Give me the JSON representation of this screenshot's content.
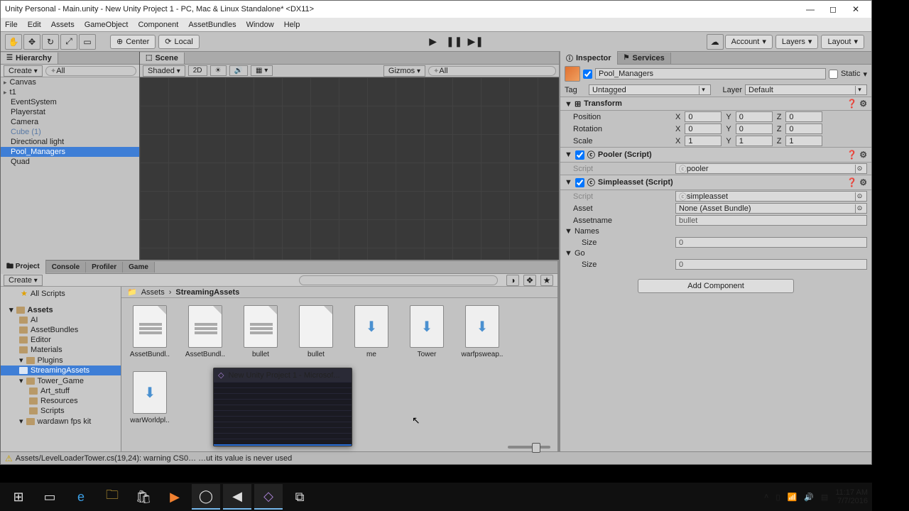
{
  "window": {
    "title": "Unity Personal - Main.unity - New Unity Project 1 - PC, Mac & Linux Standalone* <DX11>"
  },
  "menu": [
    "File",
    "Edit",
    "Assets",
    "GameObject",
    "Component",
    "AssetBundles",
    "Window",
    "Help"
  ],
  "toolbar": {
    "center": "Center",
    "local": "Local",
    "account": "Account",
    "layers": "Layers",
    "layout": "Layout"
  },
  "hierarchy": {
    "title": "Hierarchy",
    "create": "Create",
    "search_ph": "All",
    "items": [
      {
        "label": "Canvas",
        "exp": true
      },
      {
        "label": "t1",
        "exp": true
      },
      {
        "label": "EventSystem"
      },
      {
        "label": "Playerstat"
      },
      {
        "label": "Camera"
      },
      {
        "label": "Cube (1)",
        "dim": true
      },
      {
        "label": "Directional light"
      },
      {
        "label": "Pool_Managers",
        "sel": true
      },
      {
        "label": "Quad"
      }
    ]
  },
  "scene": {
    "tab": "Scene",
    "shaded": "Shaded",
    "twoD": "2D",
    "gizmos": "Gizmos",
    "search_ph": "All"
  },
  "project": {
    "tabs": [
      "Project",
      "Console",
      "Profiler",
      "Game"
    ],
    "create": "Create",
    "tree_top": [
      {
        "label": "All Scripts"
      }
    ],
    "tree": [
      {
        "label": "Assets",
        "bold": true,
        "indent": 0,
        "exp": true
      },
      {
        "label": "AI",
        "indent": 1
      },
      {
        "label": "AssetBundles",
        "indent": 1
      },
      {
        "label": "Editor",
        "indent": 1
      },
      {
        "label": "Materials",
        "indent": 1
      },
      {
        "label": "Plugins",
        "indent": 1,
        "exp": true
      },
      {
        "label": "StreamingAssets",
        "indent": 1,
        "sel": true
      },
      {
        "label": "Tower_Game",
        "indent": 1,
        "exp": true
      },
      {
        "label": "Art_stuff",
        "indent": 2
      },
      {
        "label": "Resources",
        "indent": 2
      },
      {
        "label": "Scripts",
        "indent": 2
      },
      {
        "label": "wardawn fps kit",
        "indent": 1,
        "exp": true
      }
    ],
    "breadcrumb": [
      "Assets",
      "StreamingAssets"
    ],
    "assets": [
      {
        "label": "AssetBundl..",
        "kind": "data"
      },
      {
        "label": "AssetBundl..",
        "kind": "data"
      },
      {
        "label": "bullet",
        "kind": "data"
      },
      {
        "label": "bullet",
        "kind": "blank"
      },
      {
        "label": "me",
        "kind": "asset"
      },
      {
        "label": "Tower",
        "kind": "asset"
      },
      {
        "label": "warfpsweap..",
        "kind": "asset"
      },
      {
        "label": "warWorldpl..",
        "kind": "asset"
      }
    ]
  },
  "status": {
    "text": "Assets/LevelLoaderTower.cs(19,24): warning CS0…                           …ut its value is never used"
  },
  "inspector": {
    "tab": "Inspector",
    "services": "Services",
    "name": "Pool_Managers",
    "static": "Static",
    "tagLbl": "Tag",
    "tag": "Untagged",
    "layerLbl": "Layer",
    "layer": "Default",
    "transform": {
      "title": "Transform",
      "pos": "Position",
      "rot": "Rotation",
      "scale": "Scale",
      "p": {
        "x": "0",
        "y": "0",
        "z": "0"
      },
      "r": {
        "x": "0",
        "y": "0",
        "z": "0"
      },
      "s": {
        "x": "1",
        "y": "1",
        "z": "1"
      }
    },
    "pooler": {
      "title": "Pooler (Script)",
      "scriptLbl": "Script",
      "script": "pooler"
    },
    "simple": {
      "title": "Simpleasset (Script)",
      "scriptLbl": "Script",
      "script": "simpleasset",
      "assetLbl": "Asset",
      "asset": "None (Asset Bundle)",
      "anameLbl": "Assetname",
      "aname": "bullet",
      "namesLbl": "Names",
      "sizeLbl": "Size",
      "size1": "0",
      "goLbl": "Go",
      "size2": "0"
    },
    "addComp": "Add Component"
  },
  "vs": {
    "title": "New Unity Project 1 - Microsof..."
  },
  "clock": {
    "time": "11:17 AM",
    "date": "7/7/2016"
  }
}
